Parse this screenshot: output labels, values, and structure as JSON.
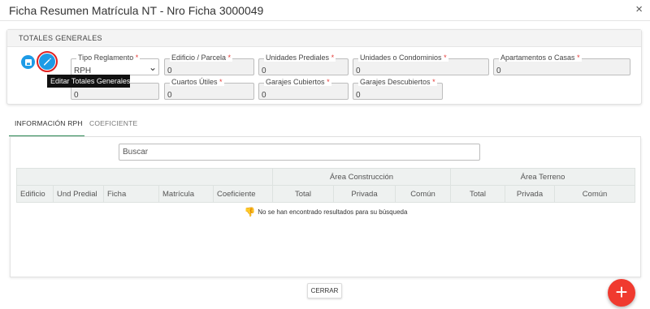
{
  "window": {
    "title": "Ficha Resumen Matrícula NT - Nro Ficha 3000049",
    "close_label": "×"
  },
  "totales": {
    "header": "TOTALES GENERALES",
    "tooltip": "Editar Totales Generales",
    "icons": {
      "save": "save-icon",
      "edit": "pencil-icon"
    },
    "fields": {
      "tipo_reglamento": {
        "label": "Tipo Reglamento",
        "value": "RPH"
      },
      "edificio_parcela": {
        "label": "Edificio / Parcela",
        "value": "0"
      },
      "unidades_prediales": {
        "label": "Unidades Prediales",
        "value": "0"
      },
      "unidades_condominios": {
        "label": "Unidades o Condominios",
        "value": "0"
      },
      "apartamentos_casas": {
        "label": "Apartamentos o Casas",
        "value": "0"
      },
      "hidden_field": {
        "value": "0"
      },
      "cuartos_utiles": {
        "label": "Cuartos Útiles",
        "value": "0"
      },
      "garajes_cubiertos": {
        "label": "Garajes Cubiertos",
        "value": "0"
      },
      "garajes_descubiertos": {
        "label": "Garajes Descubiertos",
        "value": "0"
      }
    },
    "required_mark": "*"
  },
  "tabs": [
    {
      "label": "INFORMACIÓN RPH"
    },
    {
      "label": "COEFICIENTE"
    }
  ],
  "search": {
    "placeholder": "Buscar"
  },
  "table": {
    "group_headers": [
      "Área Construcción",
      "Área Terreno"
    ],
    "columns": [
      "Edificio",
      "Und Predial",
      "Ficha",
      "Matrícula",
      "Coeficiente",
      "Total",
      "Privada",
      "Común",
      "Total",
      "Privada",
      "Común"
    ],
    "empty_message": "No se han encontrado resultados para su búsqueda",
    "empty_icon": "thumbs-down-icon"
  },
  "footer": {
    "close_label": "CERRAR",
    "fab_label": "+"
  },
  "colors": {
    "accent": "#1e9be6",
    "danger": "#f03a2f",
    "tab_active": "#2e8b57"
  }
}
